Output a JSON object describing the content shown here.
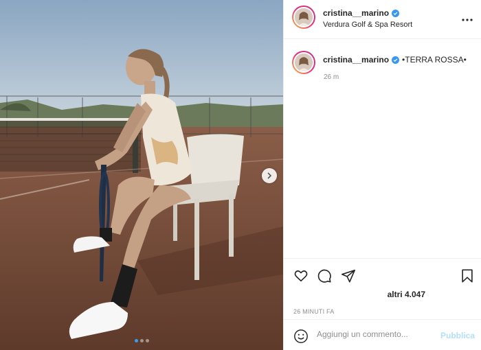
{
  "post": {
    "username": "cristina__marino",
    "location": "Verdura Golf & Spa Resort",
    "more_icon": "more-horizontal-icon",
    "verified_icon": "verified-badge-icon"
  },
  "caption": {
    "username": "cristina__marino",
    "text": "•TERRA ROSSA•",
    "relative_time": "26 m"
  },
  "media": {
    "carousel_count": 3,
    "active_index": 0,
    "next_icon": "chevron-right-icon"
  },
  "actions": {
    "like_icon": "heart-icon",
    "comment_icon": "comment-icon",
    "share_icon": "paper-plane-icon",
    "save_icon": "bookmark-icon"
  },
  "likes": {
    "label": "altri 4.047"
  },
  "timestamp": "26 MINUTI FA",
  "comment_form": {
    "emoji_icon": "smiley-icon",
    "placeholder": "Aggiungi un commento...",
    "value": "",
    "submit_label": "Pubblica"
  },
  "colors": {
    "verified": "#3897f0",
    "active_dot": "#3d9bf0",
    "publish_disabled": "#b2dffc",
    "clay_court": "#7a4f3c"
  }
}
